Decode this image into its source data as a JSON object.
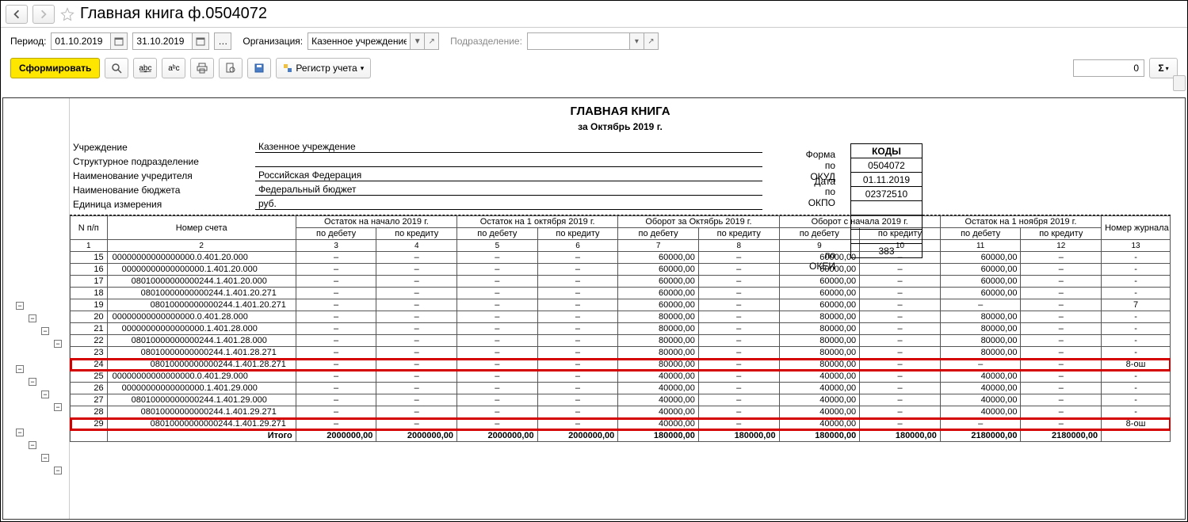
{
  "title": "Главная книга ф.0504072",
  "filter": {
    "period_label": "Период:",
    "date_from": "01.10.2019",
    "date_to": "31.10.2019",
    "org_label": "Организация:",
    "org_value": "Казенное учреждение",
    "dept_label": "Подразделение:",
    "dept_value": ""
  },
  "toolbar": {
    "generate": "Сформировать",
    "registry": "Регистр учета",
    "numeric": "0"
  },
  "report": {
    "title": "ГЛАВНАЯ КНИГА",
    "period": "за Октябрь 2019 г.",
    "rows": {
      "inst_label": "Учреждение",
      "inst_value": "Казенное учреждение",
      "struct_label": "Структурное подразделение",
      "struct_value": "",
      "founder_label": "Наименование учредителя",
      "founder_value": "Российская Федерация",
      "budget_label": "Наименование бюджета",
      "budget_value": "Федеральный бюджет",
      "unit_label": "Единица измерения",
      "unit_value": "руб."
    },
    "codes_header": "КОДЫ",
    "codes": [
      {
        "label": "Форма по ОКУД",
        "value": "0504072"
      },
      {
        "label": "Дата",
        "value": "01.11.2019"
      },
      {
        "label": "по ОКПО",
        "value": "02372510"
      },
      {
        "label": "",
        "value": ""
      },
      {
        "label": "",
        "value": ""
      },
      {
        "label": "",
        "value": ""
      },
      {
        "label": "по ОКЕИ",
        "value": "383"
      }
    ]
  },
  "columns": {
    "npp": "N п/п",
    "account": "Номер счета",
    "bal_year": "Остаток на начало 2019 г.",
    "bal_oct1": "Остаток на 1 октября 2019 г.",
    "turn_oct": "Оборот за Октябрь 2019 г.",
    "turn_year": "Оборот с начала 2019 г.",
    "bal_nov1": "Остаток на 1 ноября 2019 г.",
    "journal": "Номер журнала операций",
    "debit": "по дебету",
    "credit": "по кредиту"
  },
  "colnums": [
    "1",
    "2",
    "3",
    "4",
    "5",
    "6",
    "7",
    "8",
    "9",
    "10",
    "11",
    "12",
    "13"
  ],
  "rows": [
    {
      "n": "15",
      "acc": "00000000000000000.0.401.20.000",
      "d7": "60000,00",
      "d9": "60000,00",
      "d11": "60000,00",
      "j": "-",
      "hl": false,
      "indent": 0
    },
    {
      "n": "16",
      "acc": "00000000000000000.1.401.20.000",
      "d7": "60000,00",
      "d9": "60000,00",
      "d11": "60000,00",
      "j": "-",
      "hl": false,
      "indent": 1
    },
    {
      "n": "17",
      "acc": "08010000000000244.1.401.20.000",
      "d7": "60000,00",
      "d9": "60000,00",
      "d11": "60000,00",
      "j": "-",
      "hl": false,
      "indent": 2
    },
    {
      "n": "18",
      "acc": "08010000000000244.1.401.20.271",
      "d7": "60000,00",
      "d9": "60000,00",
      "d11": "60000,00",
      "j": "-",
      "hl": false,
      "indent": 3
    },
    {
      "n": "19",
      "acc": "08010000000000244.1.401.20.271",
      "d7": "60000,00",
      "d9": "60000,00",
      "d11": "–",
      "j": "7",
      "hl": false,
      "indent": 4,
      "d11dash": true
    },
    {
      "n": "20",
      "acc": "00000000000000000.0.401.28.000",
      "d7": "80000,00",
      "d9": "80000,00",
      "d11": "80000,00",
      "j": "-",
      "hl": false,
      "indent": 0
    },
    {
      "n": "21",
      "acc": "00000000000000000.1.401.28.000",
      "d7": "80000,00",
      "d9": "80000,00",
      "d11": "80000,00",
      "j": "-",
      "hl": false,
      "indent": 1
    },
    {
      "n": "22",
      "acc": "08010000000000244.1.401.28.000",
      "d7": "80000,00",
      "d9": "80000,00",
      "d11": "80000,00",
      "j": "-",
      "hl": false,
      "indent": 2
    },
    {
      "n": "23",
      "acc": "08010000000000244.1.401.28.271",
      "d7": "80000,00",
      "d9": "80000,00",
      "d11": "80000,00",
      "j": "-",
      "hl": false,
      "indent": 3
    },
    {
      "n": "24",
      "acc": "08010000000000244.1.401.28.271",
      "d7": "80000,00",
      "d9": "80000,00",
      "d11": "–",
      "j": "8-ош",
      "hl": true,
      "indent": 4,
      "d11dash": true
    },
    {
      "n": "25",
      "acc": "00000000000000000.0.401.29.000",
      "d7": "40000,00",
      "d9": "40000,00",
      "d11": "40000,00",
      "j": "-",
      "hl": false,
      "indent": 0
    },
    {
      "n": "26",
      "acc": "00000000000000000.1.401.29.000",
      "d7": "40000,00",
      "d9": "40000,00",
      "d11": "40000,00",
      "j": "-",
      "hl": false,
      "indent": 1
    },
    {
      "n": "27",
      "acc": "08010000000000244.1.401.29.000",
      "d7": "40000,00",
      "d9": "40000,00",
      "d11": "40000,00",
      "j": "-",
      "hl": false,
      "indent": 2
    },
    {
      "n": "28",
      "acc": "08010000000000244.1.401.29.271",
      "d7": "40000,00",
      "d9": "40000,00",
      "d11": "40000,00",
      "j": "-",
      "hl": false,
      "indent": 3
    },
    {
      "n": "29",
      "acc": "08010000000000244.1.401.29.271",
      "d7": "40000,00",
      "d9": "40000,00",
      "d11": "–",
      "j": "8-ош",
      "hl": true,
      "indent": 4,
      "d11dash": true
    }
  ],
  "totals": {
    "label": "Итого",
    "c3": "2000000,00",
    "c4": "2000000,00",
    "c5": "2000000,00",
    "c6": "2000000,00",
    "c7": "180000,00",
    "c8": "180000,00",
    "c9": "180000,00",
    "c10": "180000,00",
    "c11": "2180000,00",
    "c12": "2180000,00"
  },
  "dash": "–"
}
